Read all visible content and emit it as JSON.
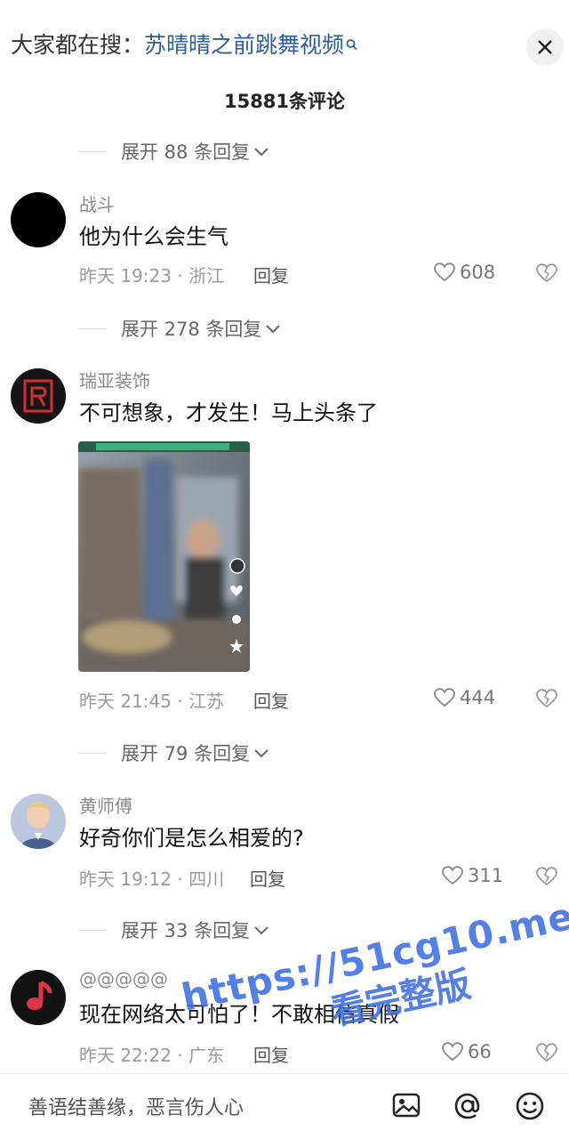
{
  "search": {
    "label": "大家都在搜：",
    "keyword": "苏晴晴之前跳舞视频"
  },
  "comment_count": "15881条评论",
  "expand_rows": [
    "展开 88 条回复",
    "展开 278 条回复",
    "展开 79 条回复",
    "展开 33 条回复"
  ],
  "comments": [
    {
      "user": "战斗",
      "text": "他为什么会生气",
      "meta": "昨天 19:23 · 浙江",
      "reply": "回复",
      "likes": "608"
    },
    {
      "user": "瑞亚装饰",
      "text": "不可想象，才发生！马上头条了",
      "meta": "昨天 21:45 · 江苏",
      "reply": "回复",
      "likes": "444"
    },
    {
      "user": "黄师傅",
      "text": "好奇你们是怎么相爱的?",
      "meta": "昨天 19:12 · 四川",
      "reply": "回复",
      "likes": "311"
    },
    {
      "user": "@@@@@",
      "text": "现在网络太可怕了！不敢相信真假",
      "meta": "昨天 22:22 · 广东",
      "reply": "回复",
      "likes": "66"
    }
  ],
  "input": {
    "placeholder": "善语结善缘，恶言伤人心"
  },
  "watermark": {
    "url": "https://51cg10.me",
    "text": "看完整版"
  },
  "colors": {
    "keyword": "#2f5f9a",
    "watermark": "#3d6ee6"
  }
}
